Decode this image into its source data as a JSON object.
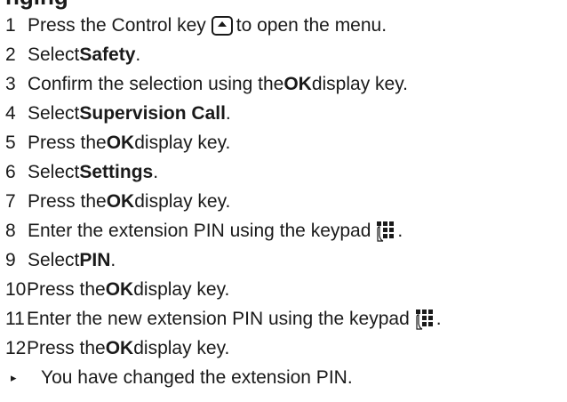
{
  "heading_fragment": "nging",
  "steps": [
    {
      "num": "1",
      "before": "Press the Control key",
      "icon": "control-key-icon",
      "after": "to open the menu."
    },
    {
      "num": "2",
      "before": "Select ",
      "bold": "Safety",
      "after": "."
    },
    {
      "num": "3",
      "before": "Confirm the selection using the ",
      "bold": "OK",
      "after": " display key."
    },
    {
      "num": "4",
      "before": "Select ",
      "bold": "Supervision Call",
      "after": "."
    },
    {
      "num": "5",
      "before": "Press the ",
      "bold": "OK",
      "after": " display key."
    },
    {
      "num": "6",
      "before": "Select ",
      "bold": "Settings",
      "after": "."
    },
    {
      "num": "7",
      "before": "Press the ",
      "bold": "OK",
      "after": " display key."
    },
    {
      "num": "8",
      "before": "Enter the extension PIN using the keypad",
      "icon": "keypad-icon",
      "after": "."
    },
    {
      "num": "9",
      "before": "Select ",
      "bold": "PIN",
      "after": "."
    },
    {
      "num": "10",
      "before": "Press the ",
      "bold": "OK",
      "after": " display key."
    },
    {
      "num": "11",
      "before": "Enter the new extension PIN using the keypad",
      "icon": "keypad-icon",
      "after": "."
    },
    {
      "num": "12",
      "before": "Press the ",
      "bold": "OK",
      "after": " display key."
    }
  ],
  "result": {
    "arrow": "▸",
    "text": "You have changed the extension PIN."
  }
}
